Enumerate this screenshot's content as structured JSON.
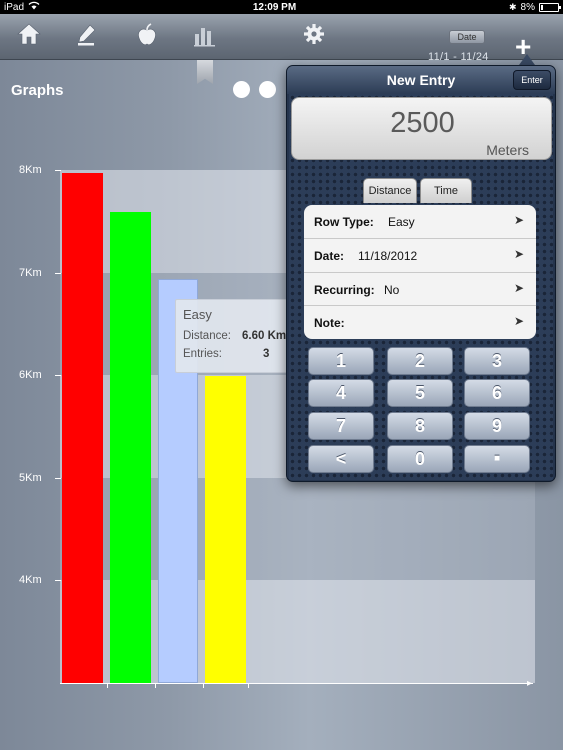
{
  "status_bar": {
    "device": "iPad",
    "time": "12:09 PM",
    "battery": "8%"
  },
  "toolbar": {
    "icons": [
      "home-icon",
      "pencil-icon",
      "apple-icon",
      "bar-chart-icon",
      "gear-icon"
    ],
    "date_label": "Date",
    "date_range": "11/1  -  11/24",
    "add_icon": "plus-icon"
  },
  "graphs": {
    "title": "Graphs",
    "page_dots": 2
  },
  "chart_data": {
    "type": "bar",
    "y_ticks": [
      "8Km",
      "7Km",
      "6Km",
      "5Km",
      "4Km"
    ],
    "ylim": [
      3000,
      8000
    ],
    "unit": "Km",
    "values": [
      7.97,
      7.59,
      6.94,
      5.99
    ],
    "colors": [
      "#ff0000",
      "#00ff00",
      "#b5ccff",
      "#ffff00"
    ],
    "grid": "horizontal bands"
  },
  "tooltip": {
    "title": "Easy",
    "distance_label": "Distance:",
    "distance_value": "6.60 Km",
    "entries_label": "Entries:",
    "entries_value": "3"
  },
  "new_entry": {
    "title": "New Entry",
    "enter_label": "Enter",
    "value": "2500",
    "unit": "Meters",
    "tabs": [
      "Distance",
      "Time"
    ],
    "rows": [
      {
        "label": "Row Type:",
        "value": "Easy"
      },
      {
        "label": "Date:",
        "value": "11/18/2012"
      },
      {
        "label": "Recurring:",
        "value": "No"
      },
      {
        "label": "Note:",
        "value": ""
      }
    ],
    "keypad": [
      "1",
      "2",
      "3",
      "4",
      "5",
      "6",
      "7",
      "8",
      "9",
      "<",
      "0",
      "."
    ]
  }
}
